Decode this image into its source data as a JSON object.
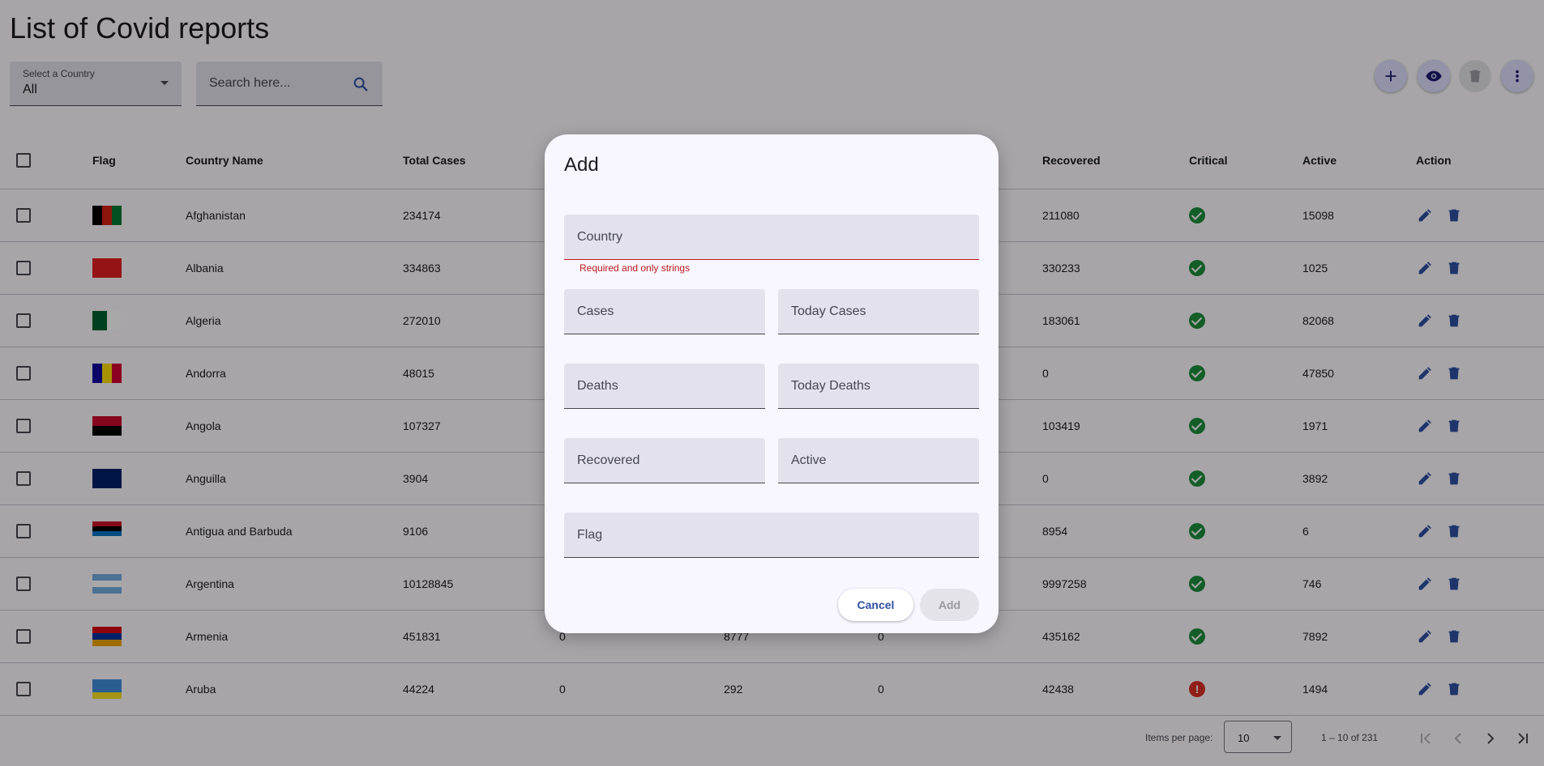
{
  "page": {
    "title": "List of Covid reports"
  },
  "filters": {
    "country_label": "Select a Country",
    "country_value": "All",
    "search_placeholder": "Search here..."
  },
  "toolbar": {
    "icons": [
      "add-icon",
      "visibility-icon",
      "delete-icon",
      "more-vert-icon"
    ]
  },
  "table": {
    "columns": [
      "Flag",
      "Country Name",
      "Total Cases",
      "",
      "",
      "",
      "Recovered",
      "Critical",
      "Active",
      "Action"
    ],
    "rows": [
      {
        "country": "Afghanistan",
        "total_cases": "234174",
        "c3": "",
        "c4": "",
        "c5": "",
        "recovered": "211080",
        "critical": "ok",
        "active": "15098",
        "flag_colors": [
          "#000000",
          "#d32011",
          "#007a36"
        ],
        "flag_orient": "v"
      },
      {
        "country": "Albania",
        "total_cases": "334863",
        "c3": "",
        "c4": "",
        "c5": "",
        "recovered": "330233",
        "critical": "ok",
        "active": "1025",
        "flag_colors": [
          "#e41e20",
          "#e41e20",
          "#e41e20"
        ],
        "flag_orient": "v"
      },
      {
        "country": "Algeria",
        "total_cases": "272010",
        "c3": "",
        "c4": "",
        "c5": "",
        "recovered": "183061",
        "critical": "ok",
        "active": "82068",
        "flag_colors": [
          "#006233",
          "#ffffff"
        ],
        "flag_orient": "v"
      },
      {
        "country": "Andorra",
        "total_cases": "48015",
        "c3": "",
        "c4": "",
        "c5": "",
        "recovered": "0",
        "critical": "ok",
        "active": "47850",
        "flag_colors": [
          "#10069f",
          "#fedd00",
          "#d50032"
        ],
        "flag_orient": "v"
      },
      {
        "country": "Angola",
        "total_cases": "107327",
        "c3": "",
        "c4": "",
        "c5": "",
        "recovered": "103419",
        "critical": "ok",
        "active": "1971",
        "flag_colors": [
          "#cc092f",
          "#000000"
        ],
        "flag_orient": "h"
      },
      {
        "country": "Anguilla",
        "total_cases": "3904",
        "c3": "",
        "c4": "",
        "c5": "",
        "recovered": "0",
        "critical": "ok",
        "active": "3892",
        "flag_colors": [
          "#012169",
          "#012169"
        ],
        "flag_orient": "h"
      },
      {
        "country": "Antigua and Barbuda",
        "total_cases": "9106",
        "c3": "",
        "c4": "",
        "c5": "",
        "recovered": "8954",
        "critical": "ok",
        "active": "6",
        "flag_colors": [
          "#ce1126",
          "#000000",
          "#0072c6",
          "#ffffff"
        ],
        "flag_orient": "h"
      },
      {
        "country": "Argentina",
        "total_cases": "10128845",
        "c3": "",
        "c4": "",
        "c5": "",
        "recovered": "9997258",
        "critical": "ok",
        "active": "746",
        "flag_colors": [
          "#74acdf",
          "#ffffff",
          "#74acdf"
        ],
        "flag_orient": "h"
      },
      {
        "country": "Armenia",
        "total_cases": "451831",
        "c3": "0",
        "c4": "8777",
        "c5": "0",
        "recovered": "435162",
        "critical": "ok",
        "active": "7892",
        "flag_colors": [
          "#d90012",
          "#0033a0",
          "#f2a800"
        ],
        "flag_orient": "h"
      },
      {
        "country": "Aruba",
        "total_cases": "44224",
        "c3": "0",
        "c4": "292",
        "c5": "0",
        "recovered": "42438",
        "critical": "warn",
        "active": "1494",
        "flag_colors": [
          "#418fde",
          "#418fde",
          "#fbe122"
        ],
        "flag_orient": "h"
      }
    ]
  },
  "paginator": {
    "items_per_page_label": "Items per page:",
    "items_per_page_value": "10",
    "range": "1 – 10 of 231"
  },
  "dialog": {
    "title": "Add",
    "fields": {
      "country": "Country",
      "cases": "Cases",
      "today_cases": "Today Cases",
      "deaths": "Deaths",
      "today_deaths": "Today Deaths",
      "recovered": "Recovered",
      "active": "Active",
      "flag": "Flag"
    },
    "country_error": "Required and only strings",
    "cancel_label": "Cancel",
    "add_label": "Add"
  },
  "colors": {
    "accent": "#2e4fa3",
    "error": "#ba1a1a",
    "success": "#1e8e3e",
    "warning": "#d93025"
  }
}
